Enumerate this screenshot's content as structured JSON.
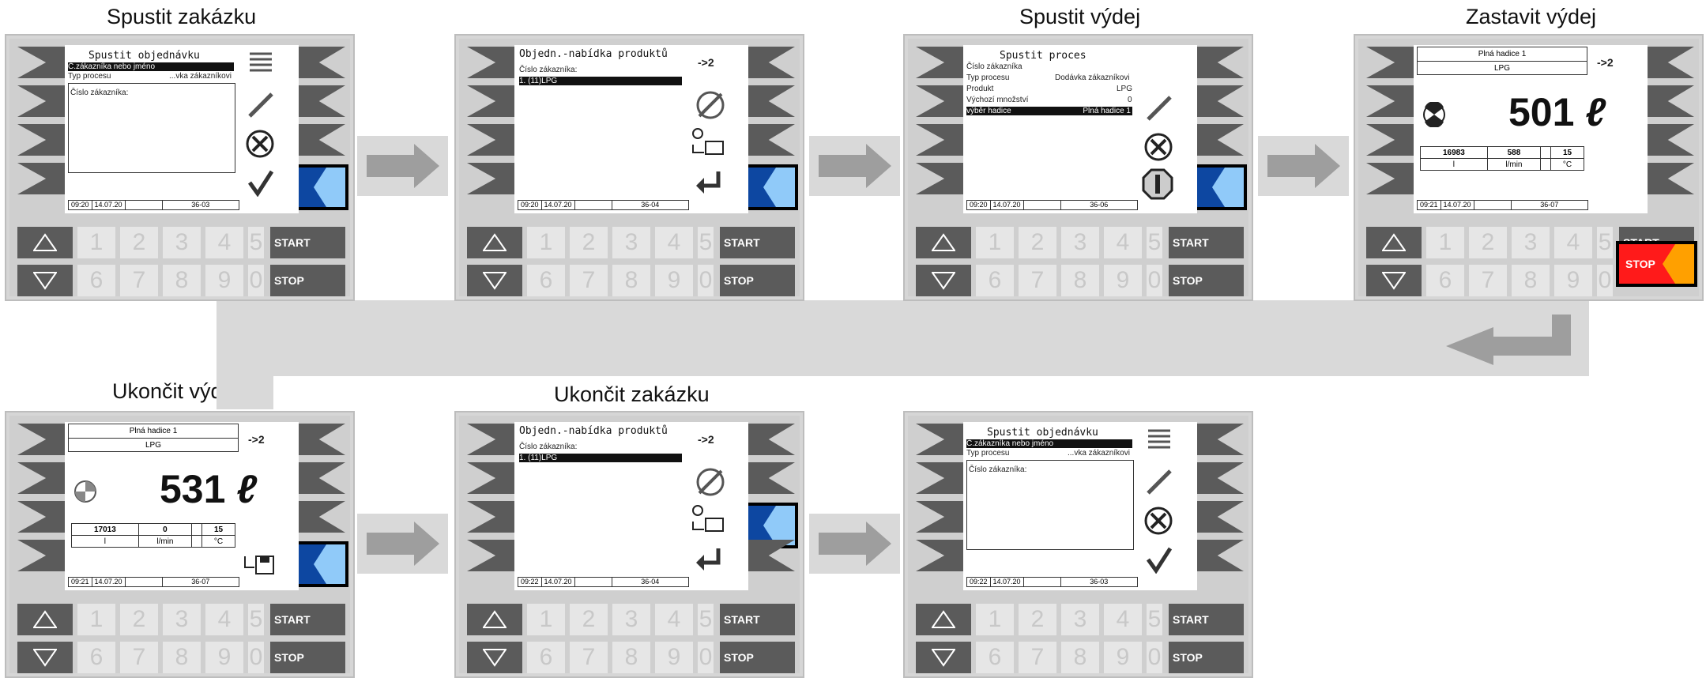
{
  "titles": {
    "t1": "Spustit zakázku",
    "t3": "Spustit výdej",
    "t4": "Zastavit výdej",
    "t5": "Ukončit výdej",
    "t6": "Ukončit zakázku"
  },
  "keys": {
    "row1": [
      "1",
      "2",
      "3",
      "4",
      "5"
    ],
    "row2": [
      "6",
      "7",
      "8",
      "9",
      "0"
    ],
    "start": "START",
    "stop": "STOP"
  },
  "screens": {
    "s1": {
      "title": "Spustit objednávku",
      "line1": "Č.zákazníka nebo jméno",
      "line2_label": "Typ procesu",
      "line2_value": "...vka zákazníkovi",
      "box_label": "Číslo zákazníka:",
      "status": [
        "09:20",
        "14.07.20",
        "",
        "36-03"
      ]
    },
    "s2": {
      "title": "Objedn.-nabídka produktů",
      "arrow": "->2",
      "label": "Číslo zákazníka:",
      "item": "1.  (11)LPG",
      "status": [
        "09:20",
        "14.07.20",
        "",
        "36-04"
      ]
    },
    "s3": {
      "title": "Spustit proces",
      "rows": [
        {
          "label": "Číslo zákazníka",
          "value": ""
        },
        {
          "label": "Typ procesu",
          "value": "Dodávka zákazníkovi"
        },
        {
          "label": "Produkt",
          "value": "LPG"
        },
        {
          "label": "Výchozí množství",
          "value": "0"
        },
        {
          "label": "výběr hadice",
          "value": "Plná hadice 1"
        }
      ],
      "status": [
        "09:20",
        "14.07.20",
        "",
        "36-06"
      ]
    },
    "s4": {
      "hose": "Plná hadice 1",
      "product": "LPG",
      "arrow": "->2",
      "volume": "501",
      "unit": "ℓ",
      "values": [
        "16983",
        "588",
        "",
        "15"
      ],
      "units": [
        "l",
        "l/min",
        "",
        "°C"
      ],
      "status": [
        "09:21",
        "14.07.20",
        "",
        "36-07"
      ]
    },
    "s5": {
      "hose": "Plná hadice 1",
      "product": "LPG",
      "arrow": "->2",
      "volume": "531",
      "unit": "ℓ",
      "values": [
        "17013",
        "0",
        "",
        "15"
      ],
      "units": [
        "l",
        "l/min",
        "",
        "°C"
      ],
      "status": [
        "09:21",
        "14.07.20",
        "",
        "36-07"
      ]
    },
    "s6": {
      "title": "Objedn.-nabídka produktů",
      "arrow": "->2",
      "label": "Číslo zákazníka:",
      "item": "1.  (11)LPG",
      "status": [
        "09:22",
        "14.07.20",
        "",
        "36-04"
      ]
    },
    "s7": {
      "title": "Spustit objednávku",
      "line1": "Č.zákazníka nebo jméno",
      "line2_label": "Typ procesu",
      "line2_value": "...vka zákazníkovi",
      "box_label": "Číslo zákazníka:",
      "status": [
        "09:22",
        "14.07.20",
        "",
        "36-03"
      ]
    }
  },
  "colors": {
    "highlight_blue": "#0d47a1",
    "highlight_light": "#90caf9",
    "stop_red": "#ff1a1a",
    "stop_orange": "#ffa000"
  }
}
